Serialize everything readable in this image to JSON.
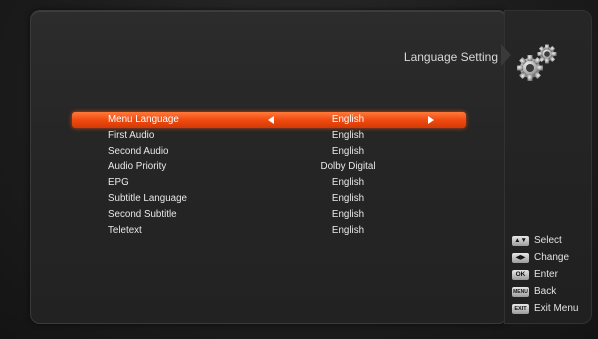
{
  "header": {
    "title": "Language Setting"
  },
  "menu": {
    "rows": [
      {
        "label": "Menu Language",
        "value": "English"
      },
      {
        "label": "First Audio",
        "value": "English"
      },
      {
        "label": "Second Audio",
        "value": "English"
      },
      {
        "label": "Audio Priority",
        "value": "Dolby Digital"
      },
      {
        "label": "EPG",
        "value": "English"
      },
      {
        "label": "Subtitle Language",
        "value": "English"
      },
      {
        "label": "Second Subtitle",
        "value": "English"
      },
      {
        "label": "Teletext",
        "value": "English"
      }
    ],
    "selected_index": 0,
    "highlight_color": "#f04a10"
  },
  "legend": {
    "items": [
      {
        "key": "▲▼",
        "label": "Select"
      },
      {
        "key": "◀▶",
        "label": "Change"
      },
      {
        "key": "OK",
        "label": "Enter"
      },
      {
        "key": "MENU",
        "label": "Back"
      },
      {
        "key": "EXIT",
        "label": "Exit Menu"
      }
    ]
  },
  "icons": {
    "settings": "gears-icon"
  }
}
